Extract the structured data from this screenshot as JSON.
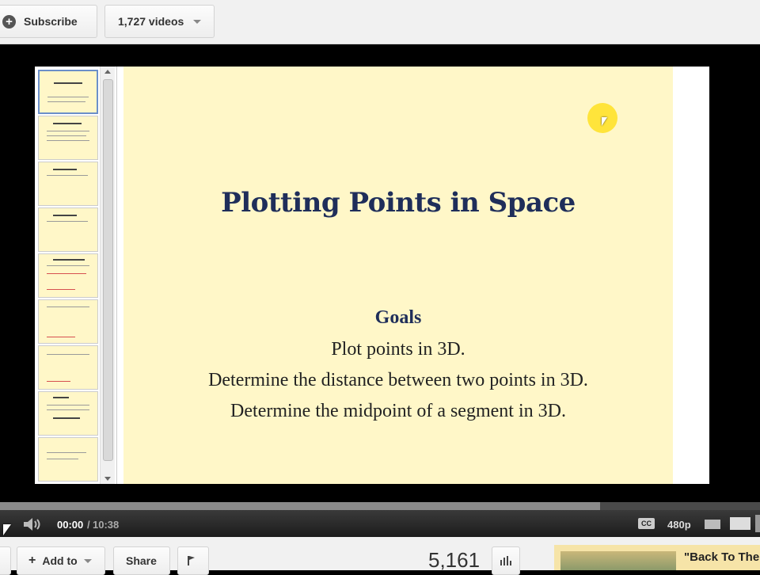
{
  "topbar": {
    "subscribe_label": "Subscribe",
    "videos_label": "1,727 videos"
  },
  "slide": {
    "title": "Plotting Points in Space",
    "goals_heading": "Goals",
    "goals": [
      "Plot points in 3D.",
      "Determine the distance between two points in 3D.",
      "Determine the midpoint of a segment in 3D."
    ]
  },
  "player": {
    "current_time": "00:00",
    "separator": "/",
    "total_time": "10:38",
    "cc_label": "CC",
    "quality": "480p",
    "progress_loaded": 0.79
  },
  "bottombar": {
    "add_to_label": "Add to",
    "share_label": "Share",
    "views": "5,161",
    "related_title": "\"Back To The"
  },
  "colors": {
    "slide_bg": "#fff7c8",
    "title_color": "#1f2e5a",
    "cursor_highlight": "#ffe43b"
  }
}
